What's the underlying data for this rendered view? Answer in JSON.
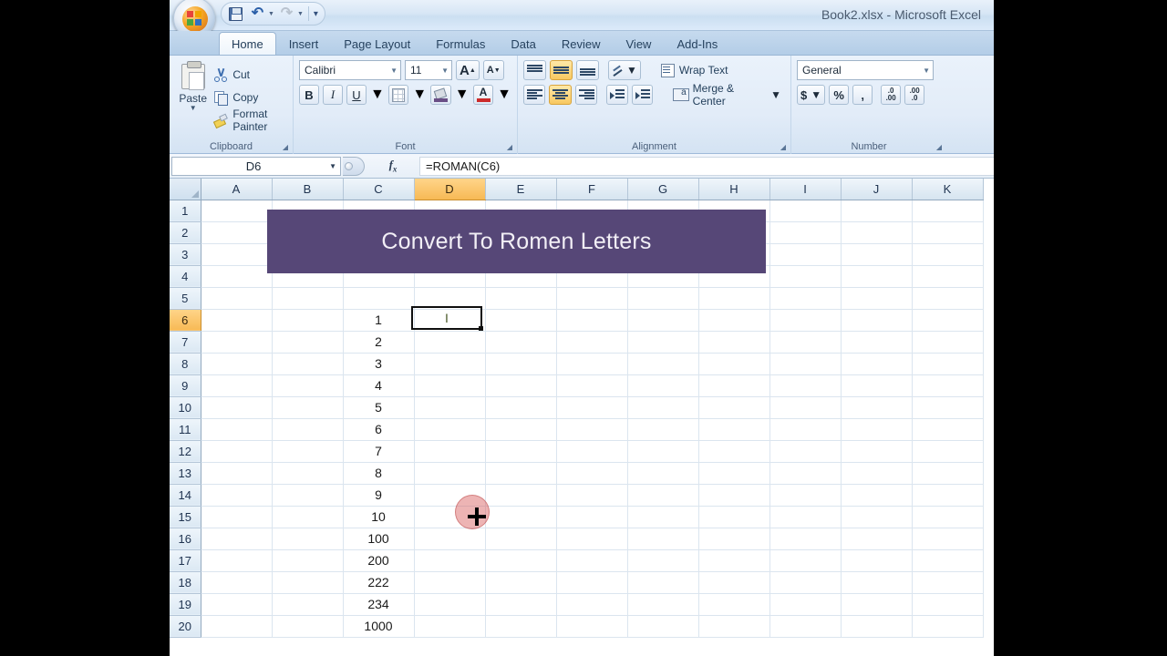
{
  "window": {
    "title": "Book2.xlsx - Microsoft Excel",
    "office_button": "office-orb"
  },
  "quick_access": {
    "save_label": "Save",
    "undo_label": "Undo",
    "redo_label": "Redo",
    "customize_label": "Customize Quick Access Toolbar"
  },
  "tabs": [
    {
      "label": "Home",
      "active": true
    },
    {
      "label": "Insert",
      "active": false
    },
    {
      "label": "Page Layout",
      "active": false
    },
    {
      "label": "Formulas",
      "active": false
    },
    {
      "label": "Data",
      "active": false
    },
    {
      "label": "Review",
      "active": false
    },
    {
      "label": "View",
      "active": false
    },
    {
      "label": "Add-Ins",
      "active": false
    }
  ],
  "ribbon": {
    "clipboard": {
      "title": "Clipboard",
      "paste": "Paste",
      "cut": "Cut",
      "copy": "Copy",
      "format_painter": "Format Painter"
    },
    "font": {
      "title": "Font",
      "font_name": "Calibri",
      "font_size": "11",
      "grow_font": "A",
      "shrink_font": "A",
      "bold": "B",
      "italic": "I",
      "underline": "U"
    },
    "alignment": {
      "title": "Alignment",
      "wrap_text": "Wrap Text",
      "merge_center": "Merge & Center"
    },
    "number": {
      "title": "Number",
      "format": "General",
      "currency": "$",
      "percent": "%",
      "comma": ",",
      "increase_decimal": ".0",
      "decrease_decimal": ".00"
    }
  },
  "formula_bar": {
    "name_box": "D6",
    "fx_label": "fx",
    "formula": "=ROMAN(C6)"
  },
  "grid": {
    "columns": [
      "A",
      "B",
      "C",
      "D",
      "E",
      "F",
      "G",
      "H",
      "I",
      "J",
      "K"
    ],
    "selected_column": "D",
    "selected_row": 6,
    "rows": [
      1,
      2,
      3,
      4,
      5,
      6,
      7,
      8,
      9,
      10,
      11,
      12,
      13,
      14,
      15,
      16,
      17,
      18,
      19,
      20
    ],
    "banner": {
      "text": "Convert To Romen Letters",
      "color": "#564777",
      "text_color": "#f2eff6"
    },
    "column_c_values": {
      "6": "1",
      "7": "2",
      "8": "3",
      "9": "4",
      "10": "5",
      "11": "6",
      "12": "7",
      "13": "8",
      "14": "9",
      "15": "10",
      "16": "100",
      "17": "200",
      "18": "222",
      "19": "234",
      "20": "1000"
    },
    "selected_cell_value": "I"
  },
  "cursor": {
    "type": "crosshair-fill-handle",
    "click_indicator_color": "#d65858"
  }
}
